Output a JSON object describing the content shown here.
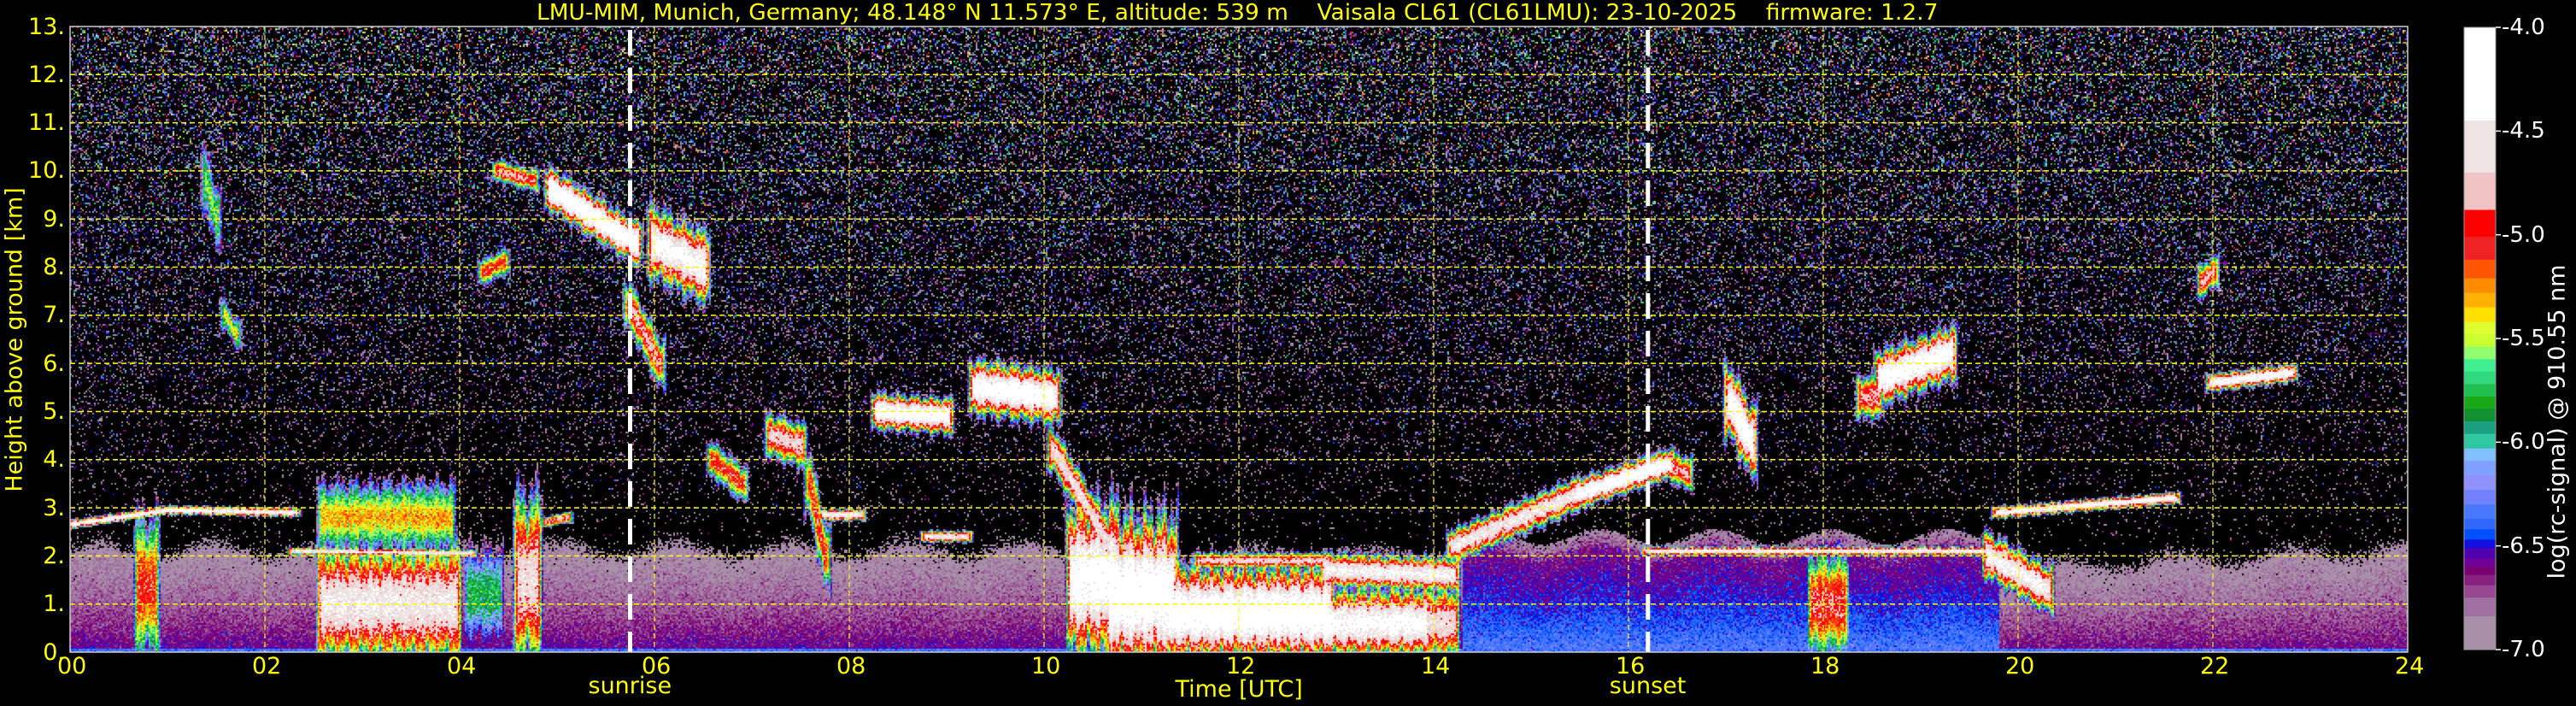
{
  "chart_data": {
    "type": "heatmap",
    "title": "LMU-MIM, Munich, Germany; 48.148° N 11.573° E, altitude: 539 m    Vaisala CL61 (CL61LMU): 23-10-2025    firmware: 1.2.7",
    "xlabel": "Time [UTC]",
    "ylabel": "Height above ground [km]",
    "xlim": [
      0,
      24
    ],
    "ylim": [
      0,
      13
    ],
    "x_ticks": [
      "00",
      "02",
      "04",
      "06",
      "08",
      "10",
      "12",
      "14",
      "16",
      "18",
      "20",
      "22",
      "24"
    ],
    "x_tick_values": [
      0,
      2,
      4,
      6,
      8,
      10,
      12,
      14,
      16,
      18,
      20,
      22,
      24
    ],
    "y_ticks": [
      "0.",
      "1.",
      "2.",
      "3.",
      "4.",
      "5.",
      "6.",
      "7.",
      "8.",
      "9.",
      "10.",
      "11.",
      "12.",
      "13."
    ],
    "y_tick_values": [
      0,
      1,
      2,
      3,
      4,
      5,
      6,
      7,
      8,
      9,
      10,
      11,
      12,
      13
    ],
    "grid": true,
    "grid_color": "#ffff00",
    "annotations": [
      {
        "label": "sunrise",
        "time": 5.75
      },
      {
        "label": "sunset",
        "time": 16.2
      }
    ],
    "colorbar": {
      "label": "log(rc-signal) @ 910.55 nm",
      "range": [
        -7.0,
        -4.0
      ],
      "ticks": [
        "-4.0",
        "-4.5",
        "-5.0",
        "-5.5",
        "-6.0",
        "-6.5",
        "-7.0"
      ],
      "tick_values": [
        -4.0,
        -4.5,
        -5.0,
        -5.5,
        -6.0,
        -6.5,
        -7.0
      ],
      "placement": "right",
      "colormap": [
        {
          "min": -4.45,
          "color": "#ffffff"
        },
        {
          "min": -4.7,
          "color": "#ede3e3"
        },
        {
          "min": -4.88,
          "color": "#f0c4c4"
        },
        {
          "min": -5.01,
          "color": "#ff0000"
        },
        {
          "min": -5.12,
          "color": "#ee2222"
        },
        {
          "min": -5.21,
          "color": "#ff5500"
        },
        {
          "min": -5.28,
          "color": "#ff8c00"
        },
        {
          "min": -5.35,
          "color": "#ffb000"
        },
        {
          "min": -5.42,
          "color": "#ffe000"
        },
        {
          "min": -5.48,
          "color": "#e0ff30"
        },
        {
          "min": -5.54,
          "color": "#c8ff30"
        },
        {
          "min": -5.6,
          "color": "#90ff70"
        },
        {
          "min": -5.66,
          "color": "#40f090"
        },
        {
          "min": -5.72,
          "color": "#30d880"
        },
        {
          "min": -5.78,
          "color": "#20c050"
        },
        {
          "min": -5.84,
          "color": "#18a818"
        },
        {
          "min": -5.9,
          "color": "#109030"
        },
        {
          "min": -5.96,
          "color": "#18a080"
        },
        {
          "min": -6.03,
          "color": "#30c8a0"
        },
        {
          "min": -6.09,
          "color": "#80c0ff"
        },
        {
          "min": -6.16,
          "color": "#80a0ff"
        },
        {
          "min": -6.23,
          "color": "#9090ff"
        },
        {
          "min": -6.3,
          "color": "#7080ff"
        },
        {
          "min": -6.37,
          "color": "#4878ff"
        },
        {
          "min": -6.42,
          "color": "#3068ff"
        },
        {
          "min": -6.47,
          "color": "#0050ff"
        },
        {
          "min": -6.51,
          "color": "#1010e0"
        },
        {
          "min": -6.56,
          "color": "#5000b0"
        },
        {
          "min": -6.6,
          "color": "#700098"
        },
        {
          "min": -6.64,
          "color": "#780070"
        },
        {
          "min": -6.69,
          "color": "#882080"
        },
        {
          "min": -6.75,
          "color": "#984890"
        },
        {
          "min": -6.84,
          "color": "#a070a0"
        },
        {
          "min": -7.0,
          "color": "#a890a8"
        }
      ]
    },
    "features": [
      {
        "time": [
          0.0,
          1.0
        ],
        "height": [
          2.65,
          2.95
        ],
        "thickness": 0.15,
        "log_signal": -4.3
      },
      {
        "time": [
          1.0,
          2.3
        ],
        "height": [
          2.95,
          2.9
        ],
        "thickness": 0.15,
        "log_signal": -4.3
      },
      {
        "time": [
          0.72,
          0.86
        ],
        "height": [
          1.35,
          1.35
        ],
        "thickness": 2.7,
        "log_signal": -5.0
      },
      {
        "time": [
          2.3,
          4.1
        ],
        "height": [
          2.1,
          2.05
        ],
        "thickness": 0.12,
        "log_signal": -4.4
      },
      {
        "time": [
          2.6,
          3.95
        ],
        "height": [
          1.0,
          1.0
        ],
        "thickness": 2.1,
        "log_signal": -4.5
      },
      {
        "time": [
          2.6,
          3.9
        ],
        "height": [
          2.8,
          2.8
        ],
        "thickness": 1.4,
        "log_signal": -5.3
      },
      {
        "time": [
          4.1,
          4.4
        ],
        "height": [
          1.2,
          1.2
        ],
        "thickness": 2.2,
        "log_signal": -5.8
      },
      {
        "time": [
          4.62,
          4.78
        ],
        "height": [
          1.5,
          1.5
        ],
        "thickness": 3.0,
        "log_signal": -4.6
      },
      {
        "time": [
          4.9,
          5.1
        ],
        "height": [
          2.7,
          2.8
        ],
        "thickness": 0.2,
        "log_signal": -4.8
      },
      {
        "time": [
          1.4,
          1.5
        ],
        "height": [
          9.8,
          9.0
        ],
        "thickness": 1.4,
        "log_signal": -5.6
      },
      {
        "time": [
          1.6,
          1.7
        ],
        "height": [
          7.0,
          6.6
        ],
        "thickness": 0.6,
        "log_signal": -5.4
      },
      {
        "time": [
          4.25,
          4.45
        ],
        "height": [
          7.9,
          8.1
        ],
        "thickness": 0.5,
        "log_signal": -5.0
      },
      {
        "time": [
          4.4,
          4.75
        ],
        "height": [
          10.0,
          9.8
        ],
        "thickness": 0.4,
        "log_signal": -4.8
      },
      {
        "time": [
          4.95,
          5.8
        ],
        "height": [
          9.6,
          8.5
        ],
        "thickness": 0.7,
        "log_signal": -4.1
      },
      {
        "time": [
          5.75,
          6.05
        ],
        "height": [
          7.2,
          6.0
        ],
        "thickness": 0.9,
        "log_signal": -4.8
      },
      {
        "time": [
          6.0,
          6.5
        ],
        "height": [
          8.5,
          8.0
        ],
        "thickness": 1.2,
        "log_signal": -4.3
      },
      {
        "time": [
          6.6,
          6.9
        ],
        "height": [
          4.0,
          3.5
        ],
        "thickness": 0.7,
        "log_signal": -5.0
      },
      {
        "time": [
          7.2,
          7.5
        ],
        "height": [
          4.5,
          4.3
        ],
        "thickness": 0.8,
        "log_signal": -4.7
      },
      {
        "time": [
          7.6,
          7.75
        ],
        "height": [
          3.5,
          2.0
        ],
        "thickness": 1.3,
        "log_signal": -5.0
      },
      {
        "time": [
          7.75,
          8.1
        ],
        "height": [
          2.85,
          2.85
        ],
        "thickness": 0.2,
        "log_signal": -4.4
      },
      {
        "time": [
          8.3,
          9.0
        ],
        "height": [
          5.0,
          4.9
        ],
        "thickness": 0.6,
        "log_signal": -4.2
      },
      {
        "time": [
          8.8,
          9.2
        ],
        "height": [
          2.4,
          2.4
        ],
        "thickness": 0.2,
        "log_signal": -4.5
      },
      {
        "time": [
          9.3,
          10.1
        ],
        "height": [
          5.5,
          5.3
        ],
        "thickness": 0.9,
        "log_signal": -4.2
      },
      {
        "time": [
          10.1,
          10.8
        ],
        "height": [
          4.2,
          1.8
        ],
        "thickness": 0.8,
        "log_signal": -4.6
      },
      {
        "time": [
          10.3,
          10.7
        ],
        "height": [
          1.5,
          1.5
        ],
        "thickness": 2.6,
        "log_signal": -4.2
      },
      {
        "time": [
          10.7,
          11.3
        ],
        "height": [
          1.2,
          1.2
        ],
        "thickness": 2.6,
        "log_signal": -4.1
      },
      {
        "time": [
          11.3,
          12.9
        ],
        "height": [
          0.8,
          0.8
        ],
        "thickness": 1.6,
        "log_signal": -4.1
      },
      {
        "time": [
          11.6,
          12.9
        ],
        "height": [
          1.9,
          1.9
        ],
        "thickness": 0.3,
        "log_signal": -4.7
      },
      {
        "time": [
          12.9,
          14.2
        ],
        "height": [
          1.7,
          1.6
        ],
        "thickness": 0.6,
        "log_signal": -4.4
      },
      {
        "time": [
          12.9,
          13.9
        ],
        "height": [
          0.6,
          0.6
        ],
        "thickness": 1.2,
        "log_signal": -4.3
      },
      {
        "time": [
          13.6,
          14.2
        ],
        "height": [
          0.6,
          0.6
        ],
        "thickness": 1.3,
        "log_signal": -4.6
      },
      {
        "time": [
          14.2,
          15.5
        ],
        "height": [
          2.2,
          3.3
        ],
        "thickness": 0.6,
        "log_signal": -4.5
      },
      {
        "time": [
          15.5,
          16.4
        ],
        "height": [
          3.3,
          3.9
        ],
        "thickness": 0.5,
        "log_signal": -4.2
      },
      {
        "time": [
          16.4,
          16.6
        ],
        "height": [
          3.9,
          3.7
        ],
        "thickness": 0.6,
        "log_signal": -4.8
      },
      {
        "time": [
          16.2,
          19.7
        ],
        "height": [
          2.1,
          2.1
        ],
        "thickness": 0.15,
        "log_signal": -4.4
      },
      {
        "time": [
          17.05,
          17.25
        ],
        "height": [
          5.2,
          4.4
        ],
        "thickness": 1.2,
        "log_signal": -4.2
      },
      {
        "time": [
          18.4,
          18.55
        ],
        "height": [
          5.3,
          5.3
        ],
        "thickness": 0.8,
        "log_signal": -4.8
      },
      {
        "time": [
          18.6,
          19.3
        ],
        "height": [
          5.7,
          6.2
        ],
        "thickness": 0.9,
        "log_signal": -4.2
      },
      {
        "time": [
          19.7,
          20.3
        ],
        "height": [
          2.0,
          1.3
        ],
        "thickness": 0.8,
        "log_signal": -4.4
      },
      {
        "time": [
          19.8,
          21.6
        ],
        "height": [
          2.9,
          3.2
        ],
        "thickness": 0.2,
        "log_signal": -4.3
      },
      {
        "time": [
          21.9,
          22.0
        ],
        "height": [
          7.7,
          7.9
        ],
        "thickness": 0.6,
        "log_signal": -4.8
      },
      {
        "time": [
          22.0,
          22.8
        ],
        "height": [
          5.6,
          5.8
        ],
        "thickness": 0.3,
        "log_signal": -4.3
      },
      {
        "time": [
          17.9,
          18.2
        ],
        "height": [
          1.0,
          1.0
        ],
        "thickness": 2.0,
        "log_signal": -4.9
      }
    ]
  }
}
